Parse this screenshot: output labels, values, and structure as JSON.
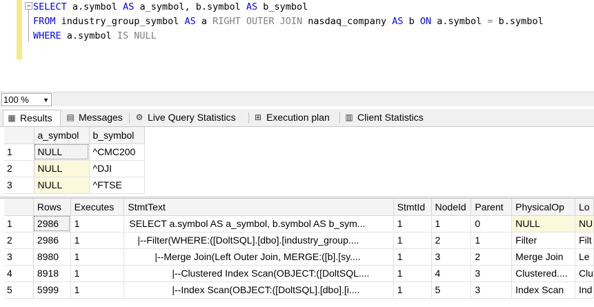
{
  "editor": {
    "line1": {
      "k1": "SELECT",
      "t1": " a.symbol ",
      "k2": "AS",
      "t2": " a_symbol, b.symbol ",
      "k3": "AS",
      "t3": " b_symbol"
    },
    "line2": {
      "k1": "FROM",
      "t1": " industry_group_symbol ",
      "k2": "AS",
      "t2": " a ",
      "g1": "RIGHT OUTER JOIN",
      "t3": " nasdaq_company ",
      "k3": "AS",
      "t4": " b ",
      "k4": "ON",
      "t5": " a.symbol ",
      "g2": "=",
      "t6": " b.symbol"
    },
    "line3": {
      "k1": "WHERE",
      "t1": " a.symbol ",
      "g1": "IS NULL"
    }
  },
  "zoom": {
    "value": "100 %"
  },
  "tabs": [
    {
      "label": "Results",
      "icon": "grid-icon"
    },
    {
      "label": "Messages",
      "icon": "message-icon"
    },
    {
      "label": "Live Query Statistics",
      "icon": "live-stats-icon"
    },
    {
      "label": "Execution plan",
      "icon": "plan-icon"
    },
    {
      "label": "Client Statistics",
      "icon": "client-stats-icon"
    }
  ],
  "grid1": {
    "headers": [
      "a_symbol",
      "b_symbol"
    ],
    "rows": [
      {
        "n": "1",
        "a": "NULL",
        "b": "^CMC200"
      },
      {
        "n": "2",
        "a": "NULL",
        "b": "^DJI"
      },
      {
        "n": "3",
        "a": "NULL",
        "b": "^FTSE"
      }
    ]
  },
  "grid2": {
    "headers": [
      "Rows",
      "Executes",
      "StmtText",
      "StmtId",
      "NodeId",
      "Parent",
      "PhysicalOp",
      "Lo"
    ],
    "rows": [
      {
        "n": "1",
        "c": [
          "2986",
          "1",
          "SELECT a.symbol AS a_symbol, b.symbol AS b_sym...",
          "1",
          "1",
          "0",
          "NULL",
          "NU"
        ]
      },
      {
        "n": "2",
        "c": [
          "2986",
          "1",
          "|--Filter(WHERE:([DoltSQL].[dbo].[industry_group....",
          "1",
          "2",
          "1",
          "Filter",
          "Filt"
        ]
      },
      {
        "n": "3",
        "c": [
          "8980",
          "1",
          "|--Merge Join(Left Outer Join, MERGE:([b].[sy....",
          "1",
          "3",
          "2",
          "Merge Join",
          "Le"
        ]
      },
      {
        "n": "4",
        "c": [
          "8918",
          "1",
          "|--Clustered Index Scan(OBJECT:([DoltSQL....",
          "1",
          "4",
          "3",
          "Clustered....",
          "Clu"
        ]
      },
      {
        "n": "5",
        "c": [
          "5999",
          "1",
          "|--Index Scan(OBJECT:([DoltSQL].[dbo].[i....",
          "1",
          "5",
          "3",
          "Index Scan",
          "Ind"
        ]
      }
    ]
  }
}
